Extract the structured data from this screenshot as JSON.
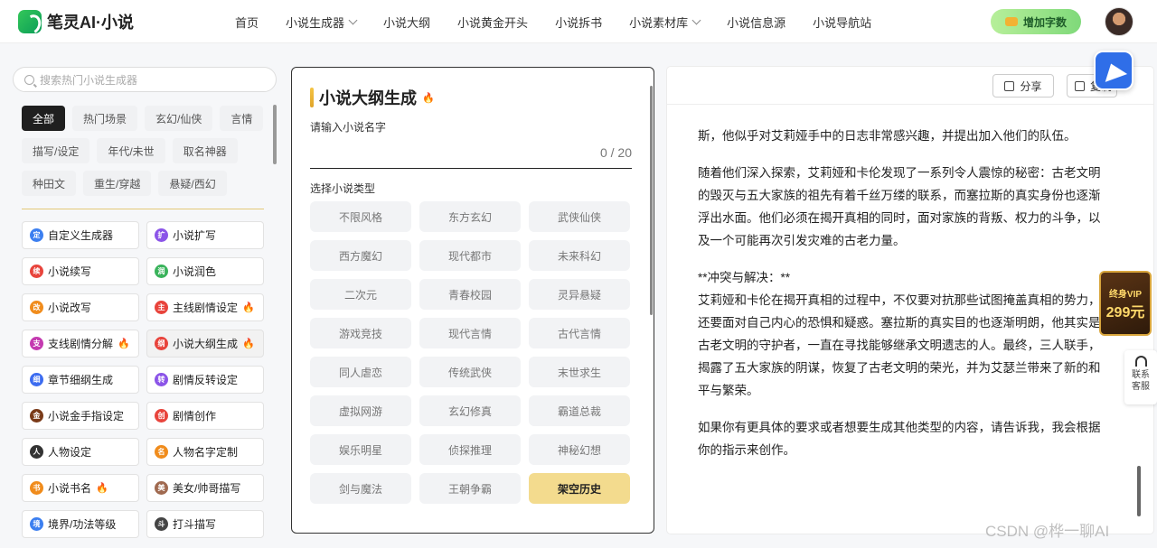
{
  "header": {
    "logo_text": "笔灵AI·小说",
    "nav": [
      {
        "label": "首页",
        "dropdown": false
      },
      {
        "label": "小说生成器",
        "dropdown": true
      },
      {
        "label": "小说大纲",
        "dropdown": false
      },
      {
        "label": "小说黄金开头",
        "dropdown": false
      },
      {
        "label": "小说拆书",
        "dropdown": false
      },
      {
        "label": "小说素材库",
        "dropdown": true
      },
      {
        "label": "小说信息源",
        "dropdown": false
      },
      {
        "label": "小说导航站",
        "dropdown": false
      }
    ],
    "add_words_label": "增加字数"
  },
  "sidebar": {
    "search_placeholder": "搜索热门小说生成器",
    "categories": [
      "全部",
      "热门场景",
      "玄幻/仙侠",
      "言情",
      "描写/设定",
      "年代/未世",
      "取名神器",
      "种田文",
      "重生/穿越",
      "悬疑/西幻"
    ],
    "active_category": 0,
    "tools": [
      {
        "label": "自定义生成器",
        "icon": "custom-generator-icon",
        "color": "#3c7ff0",
        "glyph": "定",
        "hot": false
      },
      {
        "label": "小说扩写",
        "icon": "expand-icon",
        "color": "#8b54e8",
        "glyph": "扩",
        "hot": false
      },
      {
        "label": "小说续写",
        "icon": "continue-icon",
        "color": "#e8443c",
        "glyph": "续",
        "hot": false
      },
      {
        "label": "小说润色",
        "icon": "polish-icon",
        "color": "#39b35b",
        "glyph": "润",
        "hot": false
      },
      {
        "label": "小说改写",
        "icon": "rewrite-icon",
        "color": "#f08c1c",
        "glyph": "改",
        "hot": false
      },
      {
        "label": "主线剧情设定",
        "icon": "main-plot-icon",
        "color": "#e8443c",
        "glyph": "主",
        "hot": true
      },
      {
        "label": "支线剧情分解",
        "icon": "sub-plot-icon",
        "color": "#c43ab0",
        "glyph": "支",
        "hot": true
      },
      {
        "label": "小说大纲生成",
        "icon": "outline-icon",
        "color": "#e8443c",
        "glyph": "纲",
        "hot": true
      },
      {
        "label": "章节细纲生成",
        "icon": "chapter-outline-icon",
        "color": "#3c6cf0",
        "glyph": "细",
        "hot": false
      },
      {
        "label": "剧情反转设定",
        "icon": "plot-twist-icon",
        "color": "#8b54e8",
        "glyph": "转",
        "hot": false
      },
      {
        "label": "小说金手指设定",
        "icon": "golden-finger-icon",
        "color": "#7a3a18",
        "glyph": "金",
        "hot": false
      },
      {
        "label": "剧情创作",
        "icon": "plot-create-icon",
        "color": "#e8443c",
        "glyph": "创",
        "hot": false
      },
      {
        "label": "人物设定",
        "icon": "character-icon",
        "color": "#333333",
        "glyph": "人",
        "hot": false
      },
      {
        "label": "人物名字定制",
        "icon": "character-name-icon",
        "color": "#f08c1c",
        "glyph": "名",
        "hot": false
      },
      {
        "label": "小说书名",
        "icon": "book-title-icon",
        "color": "#f08c1c",
        "glyph": "书",
        "hot": true
      },
      {
        "label": "美女/帅哥描写",
        "icon": "portrait-icon",
        "color": "#a06a50",
        "glyph": "美",
        "hot": false
      },
      {
        "label": "境界/功法等级",
        "icon": "realm-icon",
        "color": "#3c7ff0",
        "glyph": "境",
        "hot": false
      },
      {
        "label": "打斗描写",
        "icon": "fight-icon",
        "color": "#444444",
        "glyph": "斗",
        "hot": false
      }
    ],
    "active_tool": 7
  },
  "form": {
    "title": "小说大纲生成",
    "name_label": "请输入小说名字",
    "name_value": "",
    "counter": "0 / 20",
    "type_label": "选择小说类型",
    "types": [
      "不限风格",
      "东方玄幻",
      "武侠仙侠",
      "西方魔幻",
      "现代都市",
      "未来科幻",
      "二次元",
      "青春校园",
      "灵异悬疑",
      "游戏竞技",
      "现代言情",
      "古代言情",
      "同人虐恋",
      "传统武侠",
      "末世求生",
      "虚拟网游",
      "玄幻修真",
      "霸道总裁",
      "娱乐明星",
      "侦探推理",
      "神秘幻想",
      "剑与魔法",
      "王朝争霸",
      "架空历史"
    ],
    "selected_type": 23
  },
  "output": {
    "share_label": "分享",
    "copy_label": "复制",
    "paragraphs": [
      "斯，他似乎对艾莉娅手中的日志非常感兴趣，并提出加入他们的队伍。",
      "随着他们深入探索，艾莉娅和卡伦发现了一系列令人震惊的秘密：古老文明的毁灭与五大家族的祖先有着千丝万缕的联系，而塞拉斯的真实身份也逐渐浮出水面。他们必须在揭开真相的同时，面对家族的背叛、权力的斗争，以及一个可能再次引发灾难的古老力量。",
      "**冲突与解决：**\n艾莉娅和卡伦在揭开真相的过程中，不仅要对抗那些试图掩盖真相的势力，还要面对自己内心的恐惧和疑惑。塞拉斯的真实目的也逐渐明朗，他其实是古老文明的守护者，一直在寻找能够继承文明遗志的人。最终，三人联手，揭露了五大家族的阴谋，恢复了古老文明的荣光，并为艾瑟兰带来了新的和平与繁荣。",
      "如果你有更具体的要求或者想要生成其他类型的内容，请告诉我，我会根据你的指示来创作。"
    ]
  },
  "floating": {
    "vip_line1": "终身VIP",
    "vip_line2": "299元",
    "contact_line1": "联系",
    "contact_line2": "客服",
    "watermark": "CSDN @桦一聊AI"
  }
}
